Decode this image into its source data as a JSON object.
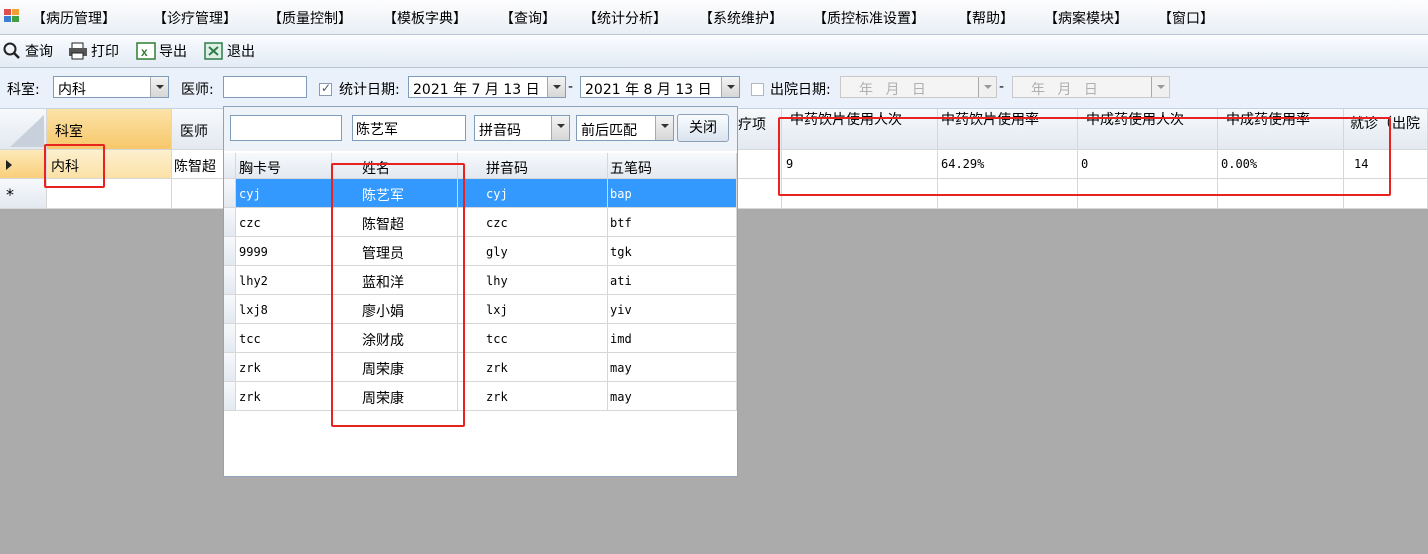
{
  "menu": [
    "【病历管理】",
    "【诊疗管理】",
    "【质量控制】",
    "【模板字典】",
    "【查询】",
    "【统计分析】",
    "【系统维护】",
    "【质控标准设置】",
    "【帮助】",
    "【病案模块】",
    "【窗口】"
  ],
  "toolbar": {
    "query": "查询",
    "print": "打印",
    "export": "导出",
    "exit": "退出"
  },
  "filter": {
    "dept_label": "科室:",
    "dept_value": "内科",
    "doctor_label": "医师:",
    "doctor_value": "",
    "stat_date_label": "统计日期:",
    "stat_date_from": "2021 年 7 月 13 日",
    "stat_date_to": "2021 年 8 月 13 日",
    "dash": "-",
    "discharge_label": "出院日期:",
    "discharge_from": "年  月  日",
    "discharge_to": "年  月  日"
  },
  "grid": {
    "headers": {
      "dept": "科室",
      "doctor": "医师",
      "therapy_tail": "疗项",
      "herb_persons": "中药饮片使用人次",
      "herb_rate": "中药饮片使用率",
      "patent_persons": "中成药使用人次",
      "patent_rate": "中成药使用率",
      "visits": "就诊（出院"
    },
    "row": {
      "dept": "内科",
      "doctor": "陈智超",
      "herb_persons": "9",
      "herb_rate": "64.29%",
      "patent_persons": "0",
      "patent_rate": "0.00%",
      "visits": "14"
    },
    "new_row_marker": "*"
  },
  "popup": {
    "search_text": "陈艺军",
    "mode": "拼音码",
    "match": "前后匹配",
    "close": "关闭",
    "columns": [
      "胸卡号",
      "姓名",
      "拼音码",
      "五笔码"
    ],
    "rows": [
      [
        "cyj",
        "陈艺军",
        "cyj",
        "bap"
      ],
      [
        "czc",
        "陈智超",
        "czc",
        "btf"
      ],
      [
        "9999",
        "管理员",
        "gly",
        "tgk"
      ],
      [
        "lhy2",
        "蓝和洋",
        "lhy",
        "ati"
      ],
      [
        "lxj8",
        "廖小娟",
        "lxj",
        "yiv"
      ],
      [
        "tcc",
        "涂财成",
        "tcc",
        "imd"
      ],
      [
        "zrk",
        "周荣康",
        "zrk",
        "may"
      ],
      [
        "zrk",
        "周荣康",
        "zrk",
        "may"
      ]
    ]
  },
  "colors": {
    "selected_row": "#3399ff",
    "highlight": "#e8231f",
    "row_header_selected": "#fbd58c"
  }
}
